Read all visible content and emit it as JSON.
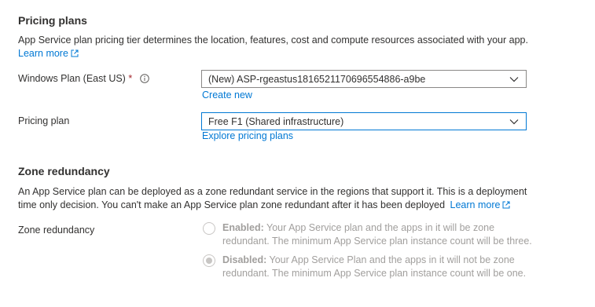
{
  "pricing": {
    "heading": "Pricing plans",
    "description": "App Service plan pricing tier determines the location, features, cost and compute resources associated with your app.",
    "learn_more": "Learn more"
  },
  "windows_plan": {
    "label": "Windows Plan (East US)",
    "required_mark": "*",
    "value": "(New) ASP-rgeastus1816521170696554886-a9be",
    "create_new": "Create new"
  },
  "pricing_plan": {
    "label": "Pricing plan",
    "value": "Free F1 (Shared infrastructure)",
    "explore": "Explore pricing plans"
  },
  "zone": {
    "heading": "Zone redundancy",
    "description_line1": "An App Service plan can be deployed as a zone redundant service in the regions that support it. This is a deployment",
    "description_line2": "time only decision. You can't make an App Service plan zone redundant after it has been deployed",
    "learn_more": "Learn more",
    "label": "Zone redundancy",
    "enabled_title": "Enabled:",
    "enabled_line1": " Your App Service plan and the apps in it will be zone",
    "enabled_line2": "redundant. The minimum App Service plan instance count will be three.",
    "disabled_title": "Disabled:",
    "disabled_line1": " Your App Service Plan and the apps in it will not be zone",
    "disabled_line2": "redundant. The minimum App Service plan instance count will be one.",
    "selected": "Disabled"
  },
  "colors": {
    "link": "#0078d4",
    "focus_border": "#0078d4",
    "disabled_text": "#a19f9d",
    "required": "#a4262c"
  }
}
